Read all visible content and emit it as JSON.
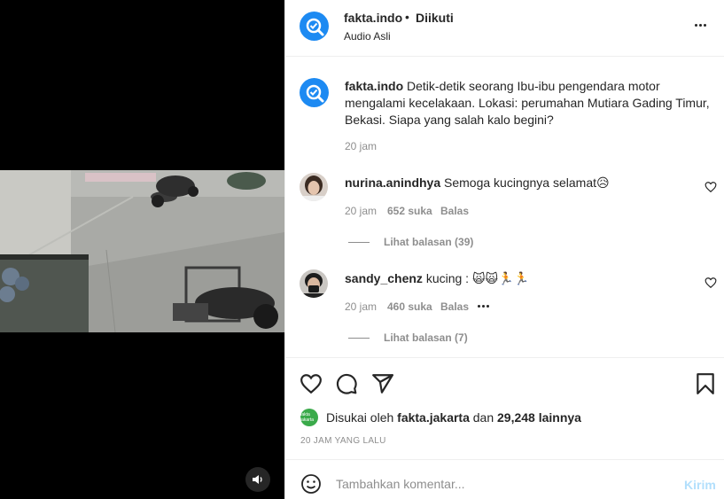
{
  "post": {
    "username": "fakta.indo",
    "follow_status": "Diikuti",
    "audio_label": "Audio Asli",
    "caption": "Detik-detik seorang Ibu-ibu pengendara motor mengalami kecelakaan. Lokasi: perumahan Mutiara Gading Timur, Bekasi. Siapa yang salah kalo begini?",
    "caption_time": "20 jam"
  },
  "comments": [
    {
      "username": "nurina.anindhya",
      "text": "Semoga kucingnya selamat😥",
      "time": "20 jam",
      "likes": "652 suka",
      "reply_label": "Balas",
      "view_replies": "Lihat balasan (39)"
    },
    {
      "username": "sandy_chenz",
      "text": "kucing : 🙀🙀🏃🏃",
      "time": "20 jam",
      "likes": "460 suka",
      "reply_label": "Balas",
      "view_replies": "Lihat balasan (7)"
    }
  ],
  "likes": {
    "prefix": "Disukai oleh",
    "liker": "fakta.jakarta",
    "middle": "dan",
    "others": "29,248 lainnya",
    "liker_avatar_text": "fakta jakarta"
  },
  "post_time": "20 JAM YANG LALU",
  "comment_box": {
    "placeholder": "Tambahkan komentar...",
    "send_label": "Kirim"
  },
  "icons": {
    "sound": "speaker-icon",
    "more": "more-options-icon",
    "like": "heart-icon",
    "comment": "comment-icon",
    "share": "share-icon",
    "save": "bookmark-icon",
    "emoji": "emoji-icon"
  },
  "colors": {
    "brand": "#1d8af2",
    "send_disabled": "#b2dffc",
    "muted_text": "#8e8e8e"
  }
}
